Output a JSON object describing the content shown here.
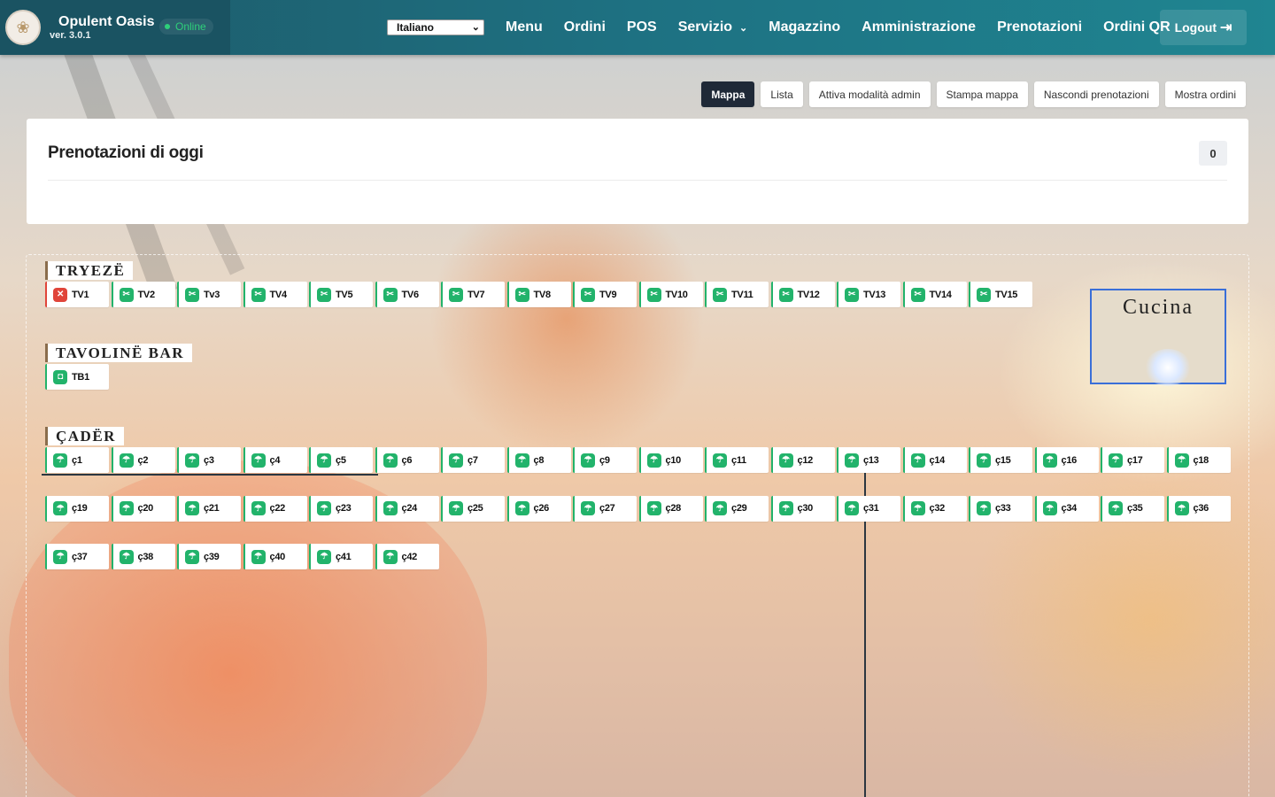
{
  "app": {
    "name": "Opulent Oasis",
    "version": "ver. 3.0.1",
    "status": "Online",
    "logo_icon": "opulent-logo"
  },
  "nav": {
    "language": "Italiano",
    "links": [
      "Menu",
      "Ordini",
      "POS",
      "Servizio",
      "Magazzino",
      "Amministrazione",
      "Prenotazioni",
      "Ordini QR"
    ],
    "logout": "Logout"
  },
  "view_buttons": [
    "Mappa",
    "Lista",
    "Attiva modalità admin",
    "Stampa mappa",
    "Nascondi prenotazioni",
    "Mostra ordini"
  ],
  "active_view": "Mappa",
  "reservations": {
    "title": "Prenotazioni di oggi",
    "count": "0"
  },
  "sections": {
    "tables": "TRYEZË",
    "bar": "TAVOLINË BAR",
    "umbrellas": "ÇADËR"
  },
  "kitchen": {
    "label": "Cucina"
  },
  "tables": [
    {
      "label": "TV1",
      "status": "busy"
    },
    {
      "label": "TV2",
      "status": "free"
    },
    {
      "label": "Tv3",
      "status": "free"
    },
    {
      "label": "TV4",
      "status": "free"
    },
    {
      "label": "TV5",
      "status": "free"
    },
    {
      "label": "TV6",
      "status": "free"
    },
    {
      "label": "TV7",
      "status": "free"
    },
    {
      "label": "TV8",
      "status": "free"
    },
    {
      "label": "TV9",
      "status": "free"
    },
    {
      "label": "TV10",
      "status": "free"
    },
    {
      "label": "TV11",
      "status": "free"
    },
    {
      "label": "TV12",
      "status": "free"
    },
    {
      "label": "TV13",
      "status": "free"
    },
    {
      "label": "TV14",
      "status": "free"
    },
    {
      "label": "TV15",
      "status": "free"
    }
  ],
  "bar_tables": [
    {
      "label": "TB1",
      "status": "free"
    }
  ],
  "umbrellas": [
    "ç1",
    "ç2",
    "ç3",
    "ç4",
    "ç5",
    "ç6",
    "ç7",
    "ç8",
    "ç9",
    "ç10",
    "ç11",
    "ç12",
    "ç13",
    "ç14",
    "ç15",
    "ç16",
    "ç17",
    "ç18",
    "ç19",
    "ç20",
    "ç21",
    "ç22",
    "ç23",
    "ç24",
    "ç25",
    "ç26",
    "ç27",
    "ç28",
    "ç29",
    "ç30",
    "ç31",
    "ç32",
    "ç33",
    "ç34",
    "ç35",
    "ç36",
    "ç37",
    "ç38",
    "ç39",
    "ç40",
    "ç41",
    "ç42"
  ],
  "colors": {
    "free": "#22b36b",
    "busy": "#e0453a",
    "navbar": "#1e7182",
    "active_button": "#1f2937"
  }
}
